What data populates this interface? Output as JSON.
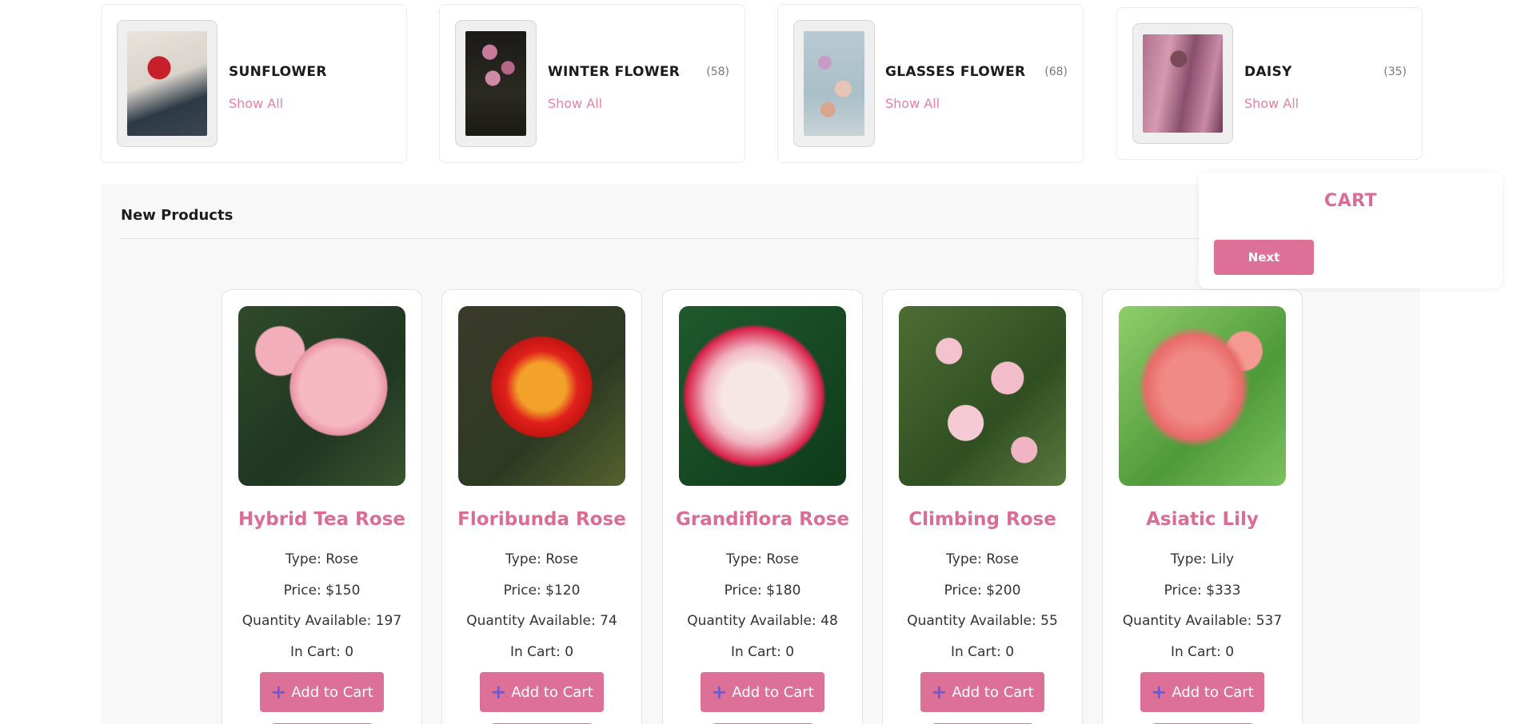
{
  "categories": [
    {
      "name": "SUNFLOWER",
      "count": "",
      "link": "Show All",
      "image_icon": "red-rose-photo"
    },
    {
      "name": "WINTER FLOWER",
      "count": "(58)",
      "link": "Show All",
      "image_icon": "pink-roses-photo"
    },
    {
      "name": "GLASSES FLOWER",
      "count": "(68)",
      "link": "Show All",
      "image_icon": "glass-flowers-photo"
    },
    {
      "name": "DAISY",
      "count": "(35)",
      "link": "Show All",
      "image_icon": "rose-shadow-photo"
    }
  ],
  "new_products": {
    "title": "New Products",
    "items": [
      {
        "name": "Hybrid Tea Rose",
        "type": "Type: Rose",
        "price": "Price: $150",
        "qty": "Quantity Available: 197",
        "in_cart": "In Cart: 0",
        "button": "Add to Cart",
        "image_icon": "pink-rose-photo"
      },
      {
        "name": "Floribunda Rose",
        "type": "Type: Rose",
        "price": "Price: $120",
        "qty": "Quantity Available: 74",
        "in_cart": "In Cart: 0",
        "button": "Add to Cart",
        "image_icon": "red-orange-rose-photo"
      },
      {
        "name": "Grandiflora Rose",
        "type": "Type: Rose",
        "price": "Price: $180",
        "qty": "Quantity Available: 48",
        "in_cart": "In Cart: 0",
        "button": "Add to Cart",
        "image_icon": "white-red-rose-photo"
      },
      {
        "name": "Climbing Rose",
        "type": "Type: Rose",
        "price": "Price: $200",
        "qty": "Quantity Available: 55",
        "in_cart": "In Cart: 0",
        "button": "Add to Cart",
        "image_icon": "climbing-roses-photo"
      },
      {
        "name": "Asiatic Lily",
        "type": "Type: Lily",
        "price": "Price: $333",
        "qty": "Quantity Available: 537",
        "in_cart": "In Cart: 0",
        "button": "Add to Cart",
        "image_icon": "pink-lily-photo"
      }
    ]
  },
  "cart": {
    "title": "CART",
    "next_label": "Next"
  },
  "colors": {
    "accent": "#dc7096",
    "accent_text": "#d96e92",
    "link": "#e5829f",
    "plus_icon": "#6a5bd8"
  }
}
